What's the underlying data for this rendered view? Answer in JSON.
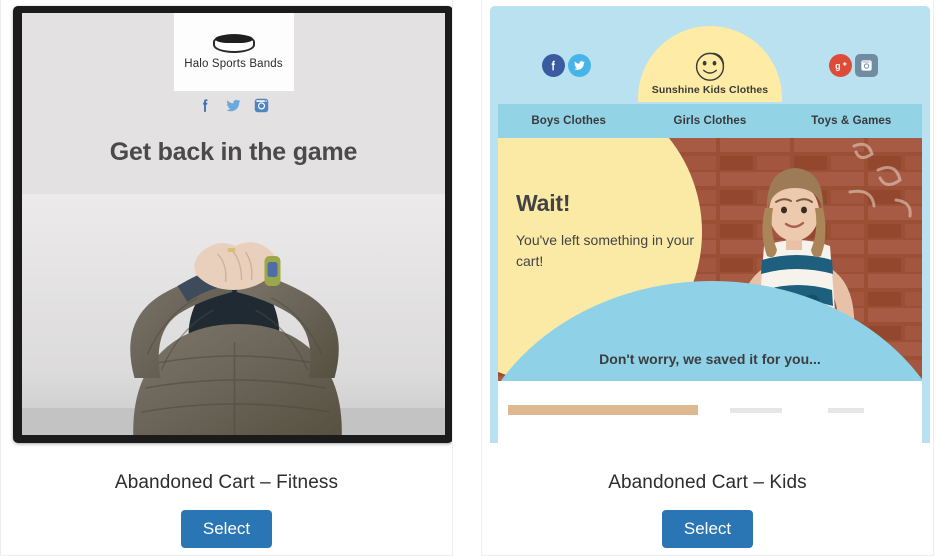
{
  "page": {
    "background": "#ffffff",
    "accent": "#2a75b3"
  },
  "templates": [
    {
      "id": "abandoned-cart-fitness",
      "caption": "Abandoned Cart – Fitness",
      "select_label": "Select",
      "preview": {
        "brand": "Halo Sports Bands",
        "logo_icon": "sports-band-icon",
        "headline": "Get back in the game",
        "background_color": "#e4e1e3",
        "frame_color": "#1b1b1b",
        "social": [
          {
            "name": "facebook-icon",
            "label": "f",
            "color": "#3b6fb6"
          },
          {
            "name": "twitter-icon",
            "label": "Twitter",
            "color": "#6aa9de"
          },
          {
            "name": "instagram-icon",
            "label": "Instagram",
            "color": "#4e86bd"
          }
        ],
        "photo_alt": "Person in puffy jacket with hands behind head wearing a fitness band"
      }
    },
    {
      "id": "abandoned-cart-kids",
      "caption": "Abandoned Cart – Kids",
      "select_label": "Select",
      "preview": {
        "brand": "Sunshine Kids Clothes",
        "logo_icon": "smiley-sun-icon",
        "background_color": "#b9e1ef",
        "sun_color": "#fdeba6",
        "nav_background": "#92d3e6",
        "nav": [
          {
            "label": "Boys Clothes"
          },
          {
            "label": "Girls Clothes"
          },
          {
            "label": "Toys & Games"
          }
        ],
        "social_left": [
          {
            "name": "facebook-icon",
            "label": "f",
            "color": "#3a5ba0"
          },
          {
            "name": "twitter-icon",
            "label": "Twitter",
            "color": "#46b4e8"
          }
        ],
        "social_right": [
          {
            "name": "google-plus-icon",
            "label": "g+",
            "color": "#dd4b39"
          },
          {
            "name": "instagram-icon",
            "label": "Instagram",
            "color": "#6f8ca0"
          }
        ],
        "hero_heading": "Wait!",
        "hero_subtext": "You've left something in your cart!",
        "blue_caption": "Don't worry, we saved it for you...",
        "photo_alt": "Young girl in striped dress standing against a brick wall"
      }
    }
  ]
}
